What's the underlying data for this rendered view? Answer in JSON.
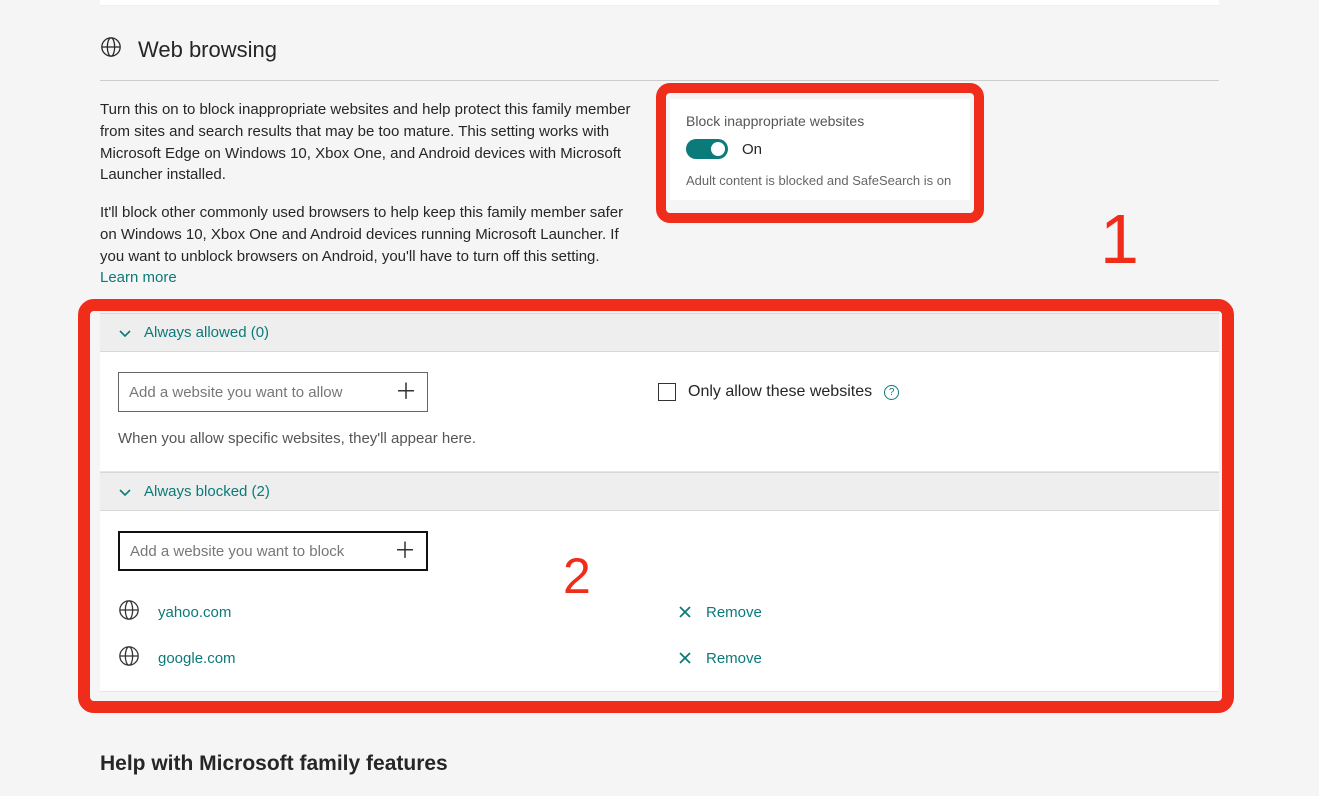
{
  "header": {
    "title": "Web browsing"
  },
  "description": {
    "p1": "Turn this on to block inappropriate websites and help protect this family member from sites and search results that may be too mature. This setting works with Microsoft Edge on Windows 10, Xbox One, and Android devices with Microsoft Launcher installed.",
    "p2": "It'll block other commonly used browsers to help keep this family member safer on Windows 10, Xbox One and Android devices running Microsoft Launcher. If you want to unblock browsers on Android, you'll have to turn off this setting. ",
    "learn_more": "Learn more"
  },
  "toggle": {
    "title": "Block inappropriate websites",
    "state": "On",
    "sub": "Adult content is blocked and SafeSearch is on"
  },
  "allowed": {
    "header": "Always allowed (0)",
    "placeholder": "Add a website you want to allow",
    "only_label": "Only allow these websites",
    "hint": "When you allow specific websites, they'll appear here."
  },
  "blocked": {
    "header": "Always blocked (2)",
    "placeholder": "Add a website you want to block",
    "remove_label": "Remove",
    "items": [
      {
        "site": "yahoo.com"
      },
      {
        "site": "google.com"
      }
    ]
  },
  "help": {
    "heading": "Help with Microsoft family features"
  },
  "annotations": {
    "n1": "1",
    "n2": "2"
  }
}
